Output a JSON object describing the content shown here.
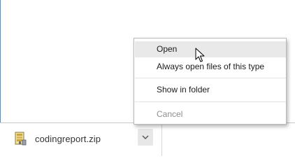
{
  "download": {
    "file_name": "codingreport.zip",
    "file_icon": "zip-archive-icon",
    "menu_button_icon": "chevron-down-icon"
  },
  "context_menu": {
    "items": [
      {
        "label": "Open",
        "state": "hover"
      },
      {
        "label": "Always open files of this type",
        "state": "normal"
      },
      {
        "label": "Show in folder",
        "state": "normal"
      },
      {
        "label": "Cancel",
        "state": "disabled"
      }
    ]
  },
  "colors": {
    "menu_hover": "#e9e9e9",
    "disabled_text": "#8f8f8f",
    "accent_edge": "#4a90d9"
  },
  "cursor_icon": "arrow-pointer-icon"
}
